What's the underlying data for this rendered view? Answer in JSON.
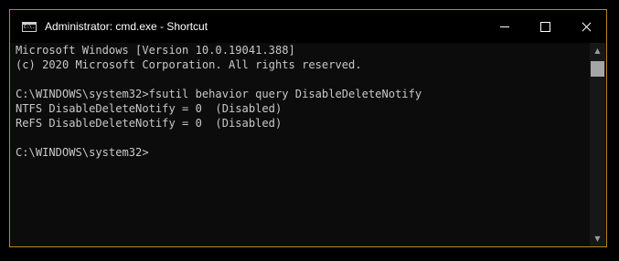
{
  "window": {
    "title": "Administrator: cmd.exe - Shortcut",
    "icon": "cmd-icon",
    "icon_text": "C:\\.",
    "controls": {
      "minimize": "minimize-icon",
      "maximize": "maximize-icon",
      "close": "close-icon"
    },
    "border_color": "#b58a18"
  },
  "console": {
    "lines": [
      "Microsoft Windows [Version 10.0.19041.388]",
      "(c) 2020 Microsoft Corporation. All rights reserved.",
      "",
      "C:\\WINDOWS\\system32>fsutil behavior query DisableDeleteNotify",
      "NTFS DisableDeleteNotify = 0  (Disabled)",
      "ReFS DisableDeleteNotify = 0  (Disabled)",
      "",
      "C:\\WINDOWS\\system32>"
    ],
    "text_color": "#c8c8c8",
    "background": "#0c0c0c"
  },
  "scrollbar": {
    "up_glyph": "▲",
    "down_glyph": "▼"
  }
}
